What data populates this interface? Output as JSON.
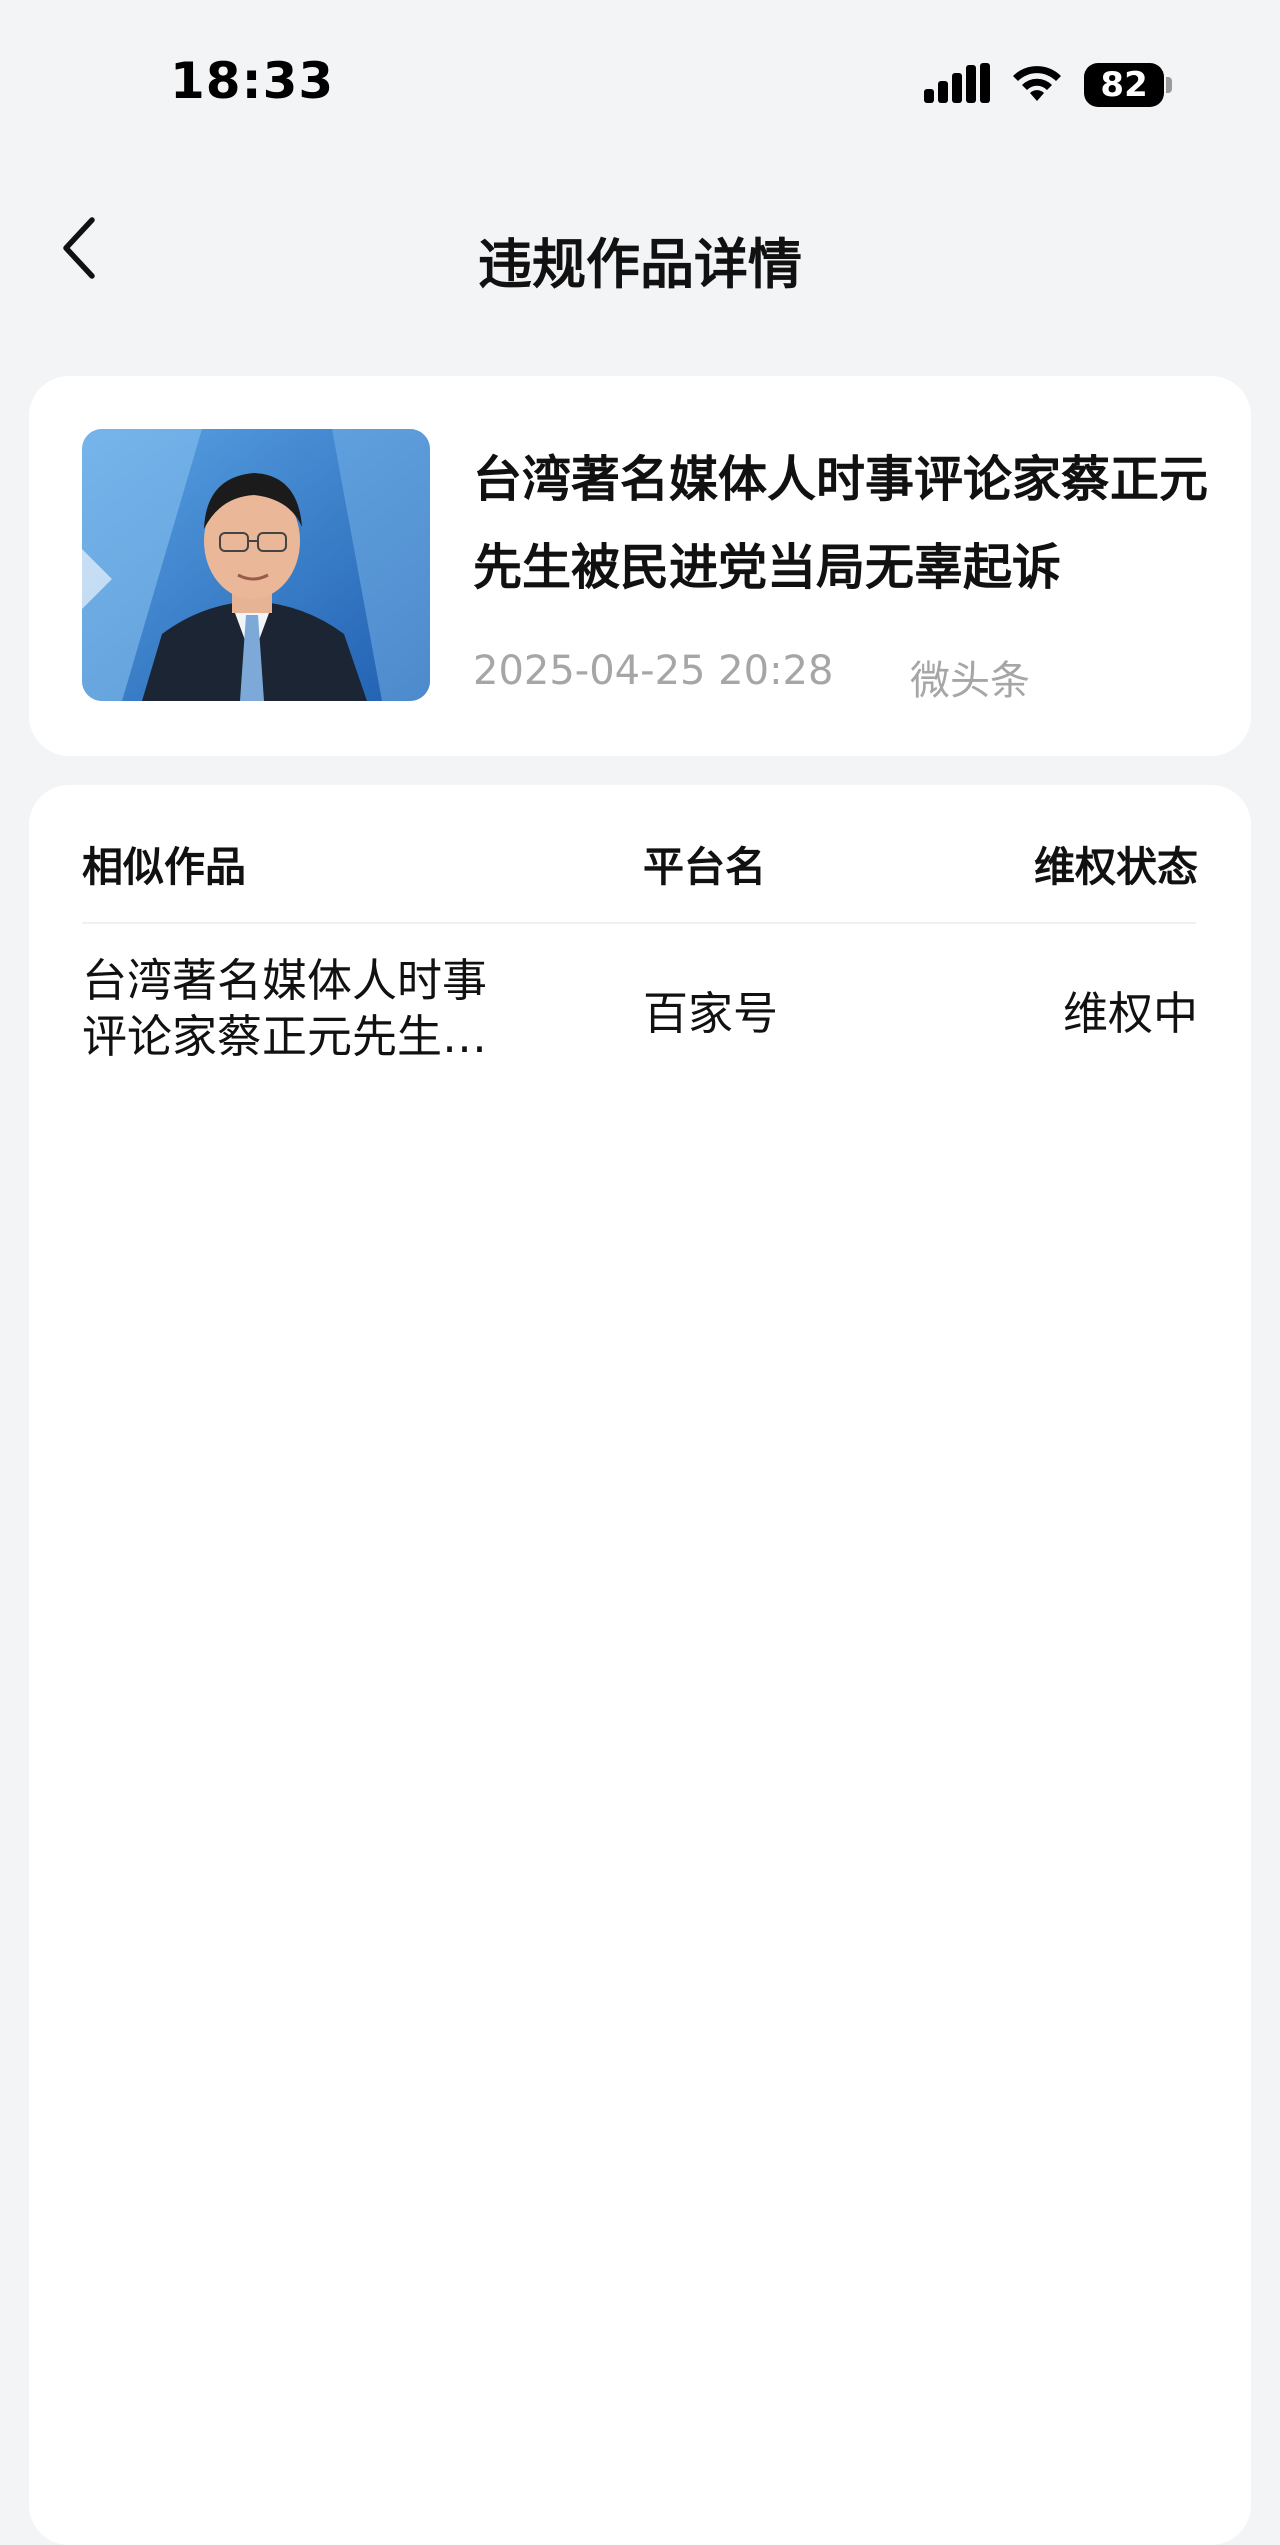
{
  "status_bar": {
    "time": "18:33",
    "battery": "82",
    "icons": [
      "signal-icon",
      "wifi-icon",
      "battery-icon"
    ]
  },
  "nav": {
    "back_icon": "chevron-left-icon",
    "title": "违规作品详情"
  },
  "work": {
    "title": "台湾著名媒体人时事评论家蔡正元先生被民进党当局无辜起诉",
    "date": "2025-04-25 20:28",
    "platform": "微头条"
  },
  "similar": {
    "headers": {
      "work": "相似作品",
      "platform": "平台名",
      "status": "维权状态"
    },
    "rows": [
      {
        "work": "台湾著名媒体人时事评论家蔡正元先生被民进党当局无辜起诉",
        "platform": "百家号",
        "status": "维权中"
      }
    ]
  },
  "colors": {
    "background": "#f3f4f6",
    "card": "#ffffff",
    "muted_text": "#a6a6a6"
  }
}
